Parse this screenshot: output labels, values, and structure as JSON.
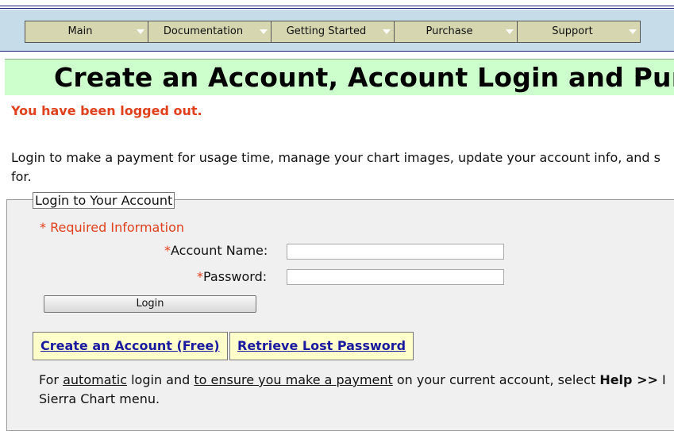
{
  "nav": {
    "items": [
      {
        "label": "Main"
      },
      {
        "label": "Documentation"
      },
      {
        "label": "Getting Started"
      },
      {
        "label": "Purchase"
      },
      {
        "label": "Support"
      }
    ]
  },
  "title": "Create an Account, Account Login and Purch",
  "status_message": "You have been logged out.",
  "intro": {
    "line1": "Login to make a payment for usage time, manage your chart images, update your account info, and s",
    "line2": "for."
  },
  "login_panel": {
    "legend": "Login to Your Account",
    "required_marker": "*",
    "required_note": "Required Information",
    "account_label": "Account Name:",
    "password_label": "Password:",
    "account_value": "",
    "password_value": "",
    "login_button": "Login",
    "create_account_link": "Create an Account (Free)",
    "retrieve_password_link": "Retrieve Lost Password",
    "footer": {
      "part1": "For ",
      "link_automatic": "automatic",
      "part2": " login and ",
      "link_ensure": "to ensure you make a payment",
      "part3": " on your current account, select ",
      "bold_help": "Help >>",
      "part4": " I",
      "line2": "Sierra Chart menu."
    }
  },
  "colors": {
    "nav_bg": "#c6dce8",
    "nav_item": "#d6d6b0",
    "title_bg": "#ccffcc",
    "alert": "#e0401c",
    "link": "#1a1aa0",
    "link_box": "#ffffcc"
  },
  "icons": {
    "nav_dropdown": "triangle-down"
  }
}
